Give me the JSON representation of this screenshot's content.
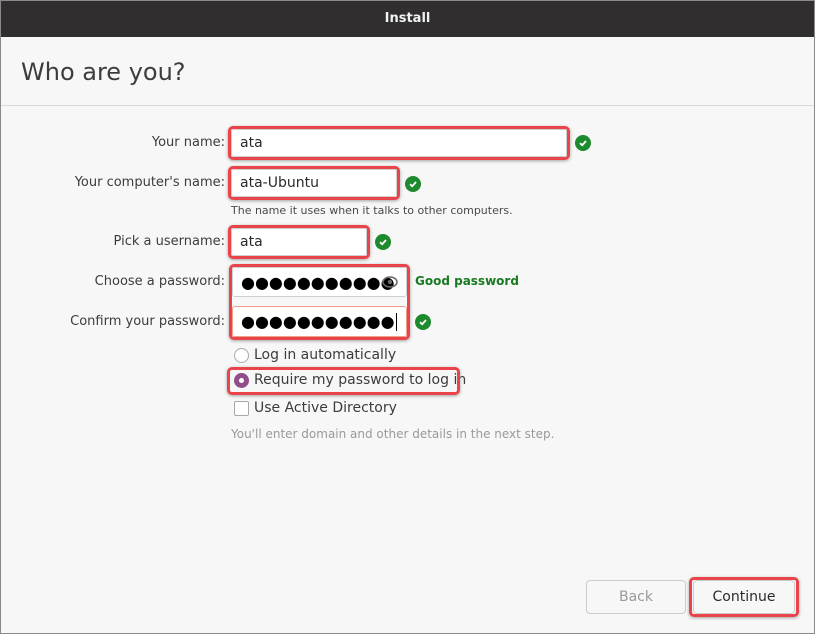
{
  "window": {
    "title": "Install"
  },
  "page": {
    "title": "Who are you?"
  },
  "form": {
    "your_name": {
      "label": "Your name:",
      "value": "ata",
      "valid": true
    },
    "computer_name": {
      "label": "Your computer's name:",
      "value": "ata-Ubuntu",
      "valid": true,
      "hint": "The name it uses when it talks to other computers."
    },
    "username": {
      "label": "Pick a username:",
      "value": "ata",
      "valid": true
    },
    "password": {
      "label": "Choose a password:",
      "masked_value": "●●●●●●●●●●●",
      "strength": "Good password",
      "reveal_icon": "eye-icon"
    },
    "confirm_password": {
      "label": "Confirm your password:",
      "masked_value": "●●●●●●●●●●●",
      "valid": true
    },
    "login_options": [
      {
        "label": "Log in automatically",
        "type": "radio",
        "selected": false
      },
      {
        "label": "Require my password to log in",
        "type": "radio",
        "selected": true
      }
    ],
    "active_directory": {
      "label": "Use Active Directory",
      "type": "checkbox",
      "checked": false,
      "hint": "You'll enter domain and other details in the next step."
    }
  },
  "buttons": {
    "back": "Back",
    "continue": "Continue"
  },
  "colors": {
    "titlebar": "#302e2f",
    "valid_green": "#1e8a2e",
    "radio_accent": "#924d8b",
    "highlight": "#e8444a"
  }
}
